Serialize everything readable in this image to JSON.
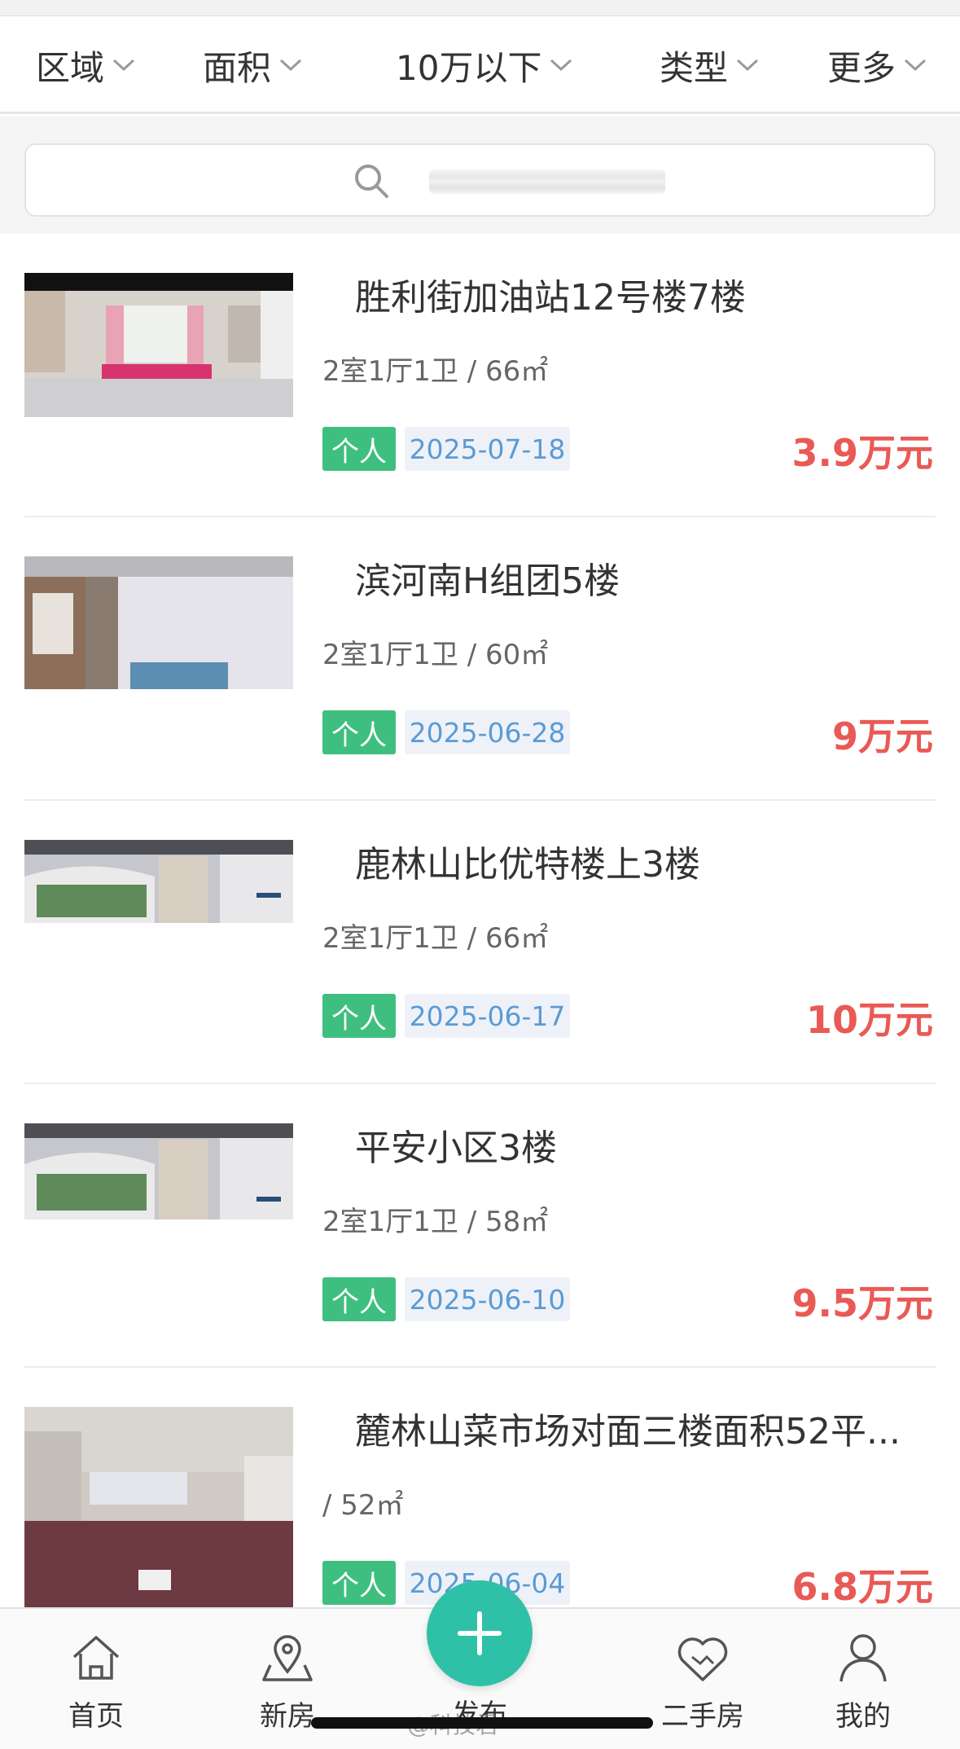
{
  "filters": [
    {
      "label": "区域"
    },
    {
      "label": "面积"
    },
    {
      "label": "10万以下"
    },
    {
      "label": "类型"
    },
    {
      "label": "更多"
    }
  ],
  "search": {
    "placeholder": "",
    "value": ""
  },
  "listings": [
    {
      "title": "胜利街加油站12号楼7楼",
      "meta": "2室1厅1卫 / 66㎡",
      "tag": "个人",
      "date": "2025-07-18",
      "price": "3.9万元"
    },
    {
      "title": "滨河南H组团5楼",
      "meta": "2室1厅1卫 / 60㎡",
      "tag": "个人",
      "date": "2025-06-28",
      "price": "9万元"
    },
    {
      "title": "鹿林山比优特楼上3楼",
      "meta": "2室1厅1卫 / 66㎡",
      "tag": "个人",
      "date": "2025-06-17",
      "price": "10万元"
    },
    {
      "title": "平安小区3楼",
      "meta": "2室1厅1卫 / 58㎡",
      "tag": "个人",
      "date": "2025-06-10",
      "price": "9.5万元"
    },
    {
      "title": "麓林山菜市场对面三楼面积52平...",
      "meta": "/ 52㎡",
      "tag": "个人",
      "date": "2025-06-04",
      "price": "6.8万元"
    }
  ],
  "tabs": [
    {
      "label": "首页",
      "icon": "home-icon"
    },
    {
      "label": "新房",
      "icon": "location-pin-icon"
    },
    {
      "label": "发布",
      "icon": "plus-icon"
    },
    {
      "label": "二手房",
      "icon": "handshake-icon"
    },
    {
      "label": "我的",
      "icon": "user-icon"
    }
  ],
  "watermark": "@科技君",
  "colors": {
    "price": "#e95a55",
    "tag_person": "#3fbf7f",
    "date_text": "#5b9bd5",
    "post_button": "#2fc1a8"
  }
}
